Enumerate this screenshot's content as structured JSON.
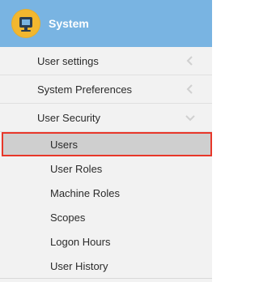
{
  "header": {
    "title": "System",
    "icon": "system-monitor-icon"
  },
  "menu": {
    "items": [
      {
        "label": "User settings",
        "icon": "chevron-left-icon",
        "expanded": false
      },
      {
        "label": "System Preferences",
        "icon": "chevron-left-icon",
        "expanded": false
      },
      {
        "label": "User Security",
        "icon": "chevron-down-icon",
        "expanded": true
      }
    ],
    "subitems": [
      {
        "label": "Users",
        "selected": true
      },
      {
        "label": "User Roles"
      },
      {
        "label": "Machine Roles"
      },
      {
        "label": "Scopes"
      },
      {
        "label": "Logon Hours"
      },
      {
        "label": "User History"
      }
    ]
  },
  "colors": {
    "header_bg": "#79b4e2",
    "icon_bg": "#f2b72f",
    "highlight_outline": "#e8372a",
    "selected_bg": "#cfcfcf",
    "sidebar_bg": "#f2f2f2"
  }
}
